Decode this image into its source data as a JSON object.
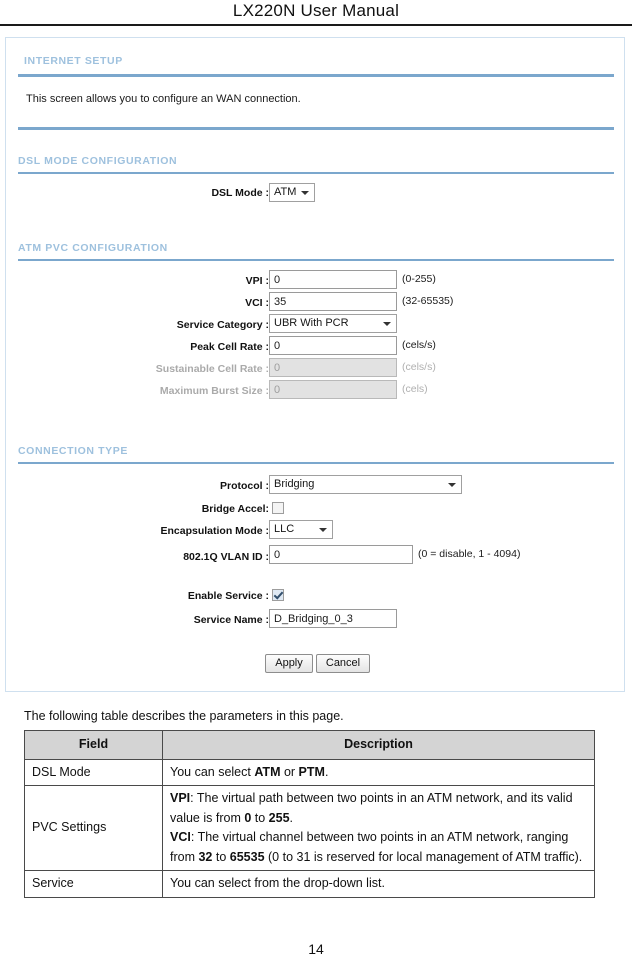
{
  "document": {
    "header_title": "LX220N User Manual",
    "page_number": "14"
  },
  "panel": {
    "title": "INTERNET SETUP",
    "intro": "This screen allows you to configure an WAN connection.",
    "dsl_section": {
      "title": "DSL MODE CONFIGURATION",
      "dsl_mode_label": "DSL Mode :",
      "dsl_mode_value": "ATM"
    },
    "pvc_section": {
      "title": "ATM PVC CONFIGURATION",
      "vpi_label": "VPI :",
      "vpi_value": "0",
      "vpi_hint": "(0-255)",
      "vci_label": "VCI :",
      "vci_value": "35",
      "vci_hint": "(32-65535)",
      "service_category_label": "Service Category :",
      "service_category_value": "UBR With PCR",
      "peak_cell_rate_label": "Peak Cell Rate :",
      "peak_cell_rate_value": "0",
      "peak_cell_rate_hint": "(cels/s)",
      "sustainable_cell_rate_label": "Sustainable Cell Rate :",
      "sustainable_cell_rate_value": "0",
      "sustainable_cell_rate_hint": "(cels/s)",
      "maximum_burst_size_label": "Maximum Burst Size :",
      "maximum_burst_size_value": "0",
      "maximum_burst_size_hint": "(cels)"
    },
    "connection_section": {
      "title": "CONNECTION TYPE",
      "protocol_label": "Protocol :",
      "protocol_value": "Bridging",
      "bridge_accel_label": "Bridge Accel:",
      "encapsulation_label": "Encapsulation Mode :",
      "encapsulation_value": "LLC",
      "vlan_label": "802.1Q VLAN ID :",
      "vlan_value": "0",
      "vlan_hint": "(0 = disable, 1 - 4094)",
      "enable_service_label": "Enable Service :",
      "service_name_label": "Service Name :",
      "service_name_value": "D_Bridging_0_3",
      "apply_label": "Apply",
      "cancel_label": "Cancel"
    }
  },
  "table": {
    "caption": "The following table describes the parameters in this page.",
    "headers": [
      "Field",
      "Description"
    ],
    "rows": [
      {
        "field": "DSL Mode",
        "description_parts": [
          {
            "t": "You can select ",
            "b": false
          },
          {
            "t": "ATM",
            "b": true
          },
          {
            "t": " or ",
            "b": false
          },
          {
            "t": "PTM",
            "b": true
          },
          {
            "t": ".",
            "b": false
          }
        ]
      },
      {
        "field": "PVC Settings",
        "description_parts": [
          {
            "t": "VPI",
            "b": true
          },
          {
            "t": ": The virtual path between two points in an ATM network, and its valid value is from ",
            "b": false
          },
          {
            "t": "0",
            "b": true
          },
          {
            "t": " to ",
            "b": false
          },
          {
            "t": "255",
            "b": true
          },
          {
            "t": ".",
            "b": false
          },
          {
            "t": "\n",
            "b": false
          },
          {
            "t": "VCI",
            "b": true
          },
          {
            "t": ": The virtual channel between two points in an ATM network, ranging from ",
            "b": false
          },
          {
            "t": "32",
            "b": true
          },
          {
            "t": " to ",
            "b": false
          },
          {
            "t": "65535",
            "b": true
          },
          {
            "t": " (0 to 31 is reserved for local management of ATM traffic).",
            "b": false
          }
        ]
      },
      {
        "field": "Service",
        "description_parts": [
          {
            "t": "You can select from the drop-down list.",
            "b": false
          }
        ]
      }
    ]
  }
}
